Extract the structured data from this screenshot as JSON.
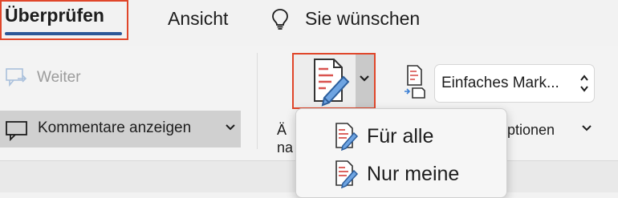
{
  "tabs": [
    {
      "label": "Überprüfen",
      "active": true
    },
    {
      "label": "Ansicht",
      "active": false
    }
  ],
  "tell_me": {
    "label": "Sie wünschen",
    "icon": "lightbulb-icon"
  },
  "ribbon": {
    "next_label": "Weiter",
    "show_comments_label": "Kommentare anzeigen",
    "track_changes_label_line1": "Ä",
    "track_changes_label_line2": "na",
    "markup_select_value": "Einfaches Mark...",
    "options_label": "optionen"
  },
  "track_changes_menu": {
    "items": [
      {
        "label": "Für alle",
        "icon": "track-changes-icon"
      },
      {
        "label": "Nur meine",
        "icon": "track-changes-icon"
      }
    ]
  },
  "colors": {
    "highlight_border": "#e0462a",
    "active_underline": "#2b5797",
    "pencil_blue": "#3b7fd4",
    "doc_red_lines": "#d9534f"
  }
}
